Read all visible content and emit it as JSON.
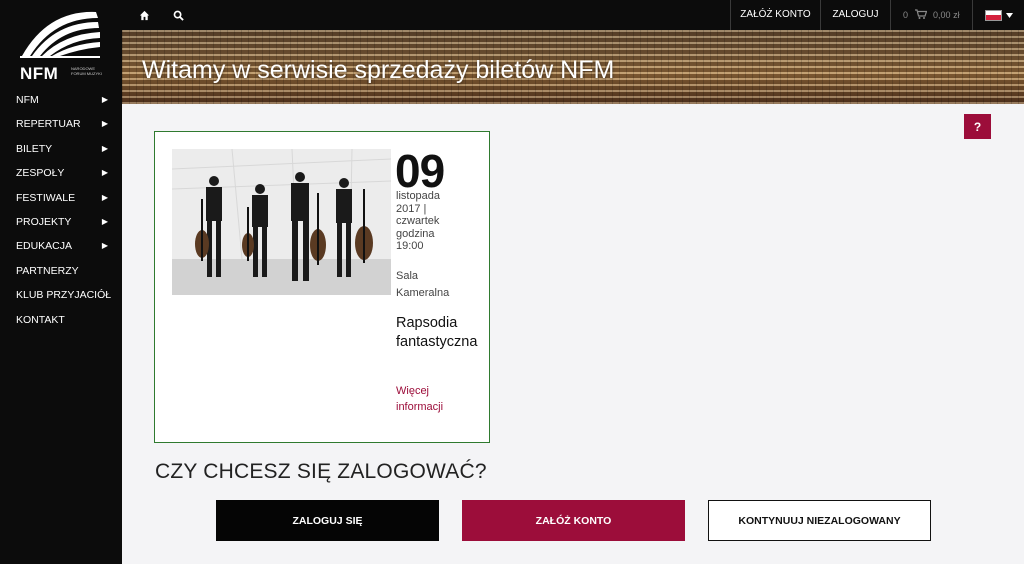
{
  "brand": {
    "logo_text": "NFM",
    "logo_subtitle": "NARODOWE FORUM MUZYKI"
  },
  "sidebar": {
    "items": [
      {
        "label": "NFM",
        "has_arrow": true
      },
      {
        "label": "REPERTUAR",
        "has_arrow": true
      },
      {
        "label": "BILETY",
        "has_arrow": true
      },
      {
        "label": "ZESPOŁY",
        "has_arrow": true
      },
      {
        "label": "FESTIWALE",
        "has_arrow": true
      },
      {
        "label": "PROJEKTY",
        "has_arrow": true
      },
      {
        "label": "EDUKACJA",
        "has_arrow": true
      },
      {
        "label": "PARTNERZY",
        "has_arrow": false
      },
      {
        "label": "KLUB PRZYJACIÓŁ",
        "has_arrow": false
      },
      {
        "label": "KONTAKT",
        "has_arrow": false
      }
    ]
  },
  "topbar": {
    "home_icon": "home-icon",
    "search_icon": "search-icon",
    "register_label": "ZAŁÓŻ KONTO",
    "login_label": "ZALOGUJ",
    "cart_count": "0",
    "cart_total": "0,00 zł",
    "language": "pl"
  },
  "banner": {
    "title": "Witamy w serwisie sprzedaży biletów NFM"
  },
  "help": {
    "label": "?"
  },
  "event": {
    "day": "09",
    "date_lines": [
      "listopada",
      "2017 |",
      "czwartek",
      "godzina",
      "19:00"
    ],
    "venue_lines": [
      "Sala",
      "Kameralna"
    ],
    "title": "Rapsodia fantastyczna",
    "more_lines": [
      "Więcej",
      "informacji"
    ]
  },
  "login_prompt": {
    "question": "CZY CHCESZ SIĘ ZALOGOWAĆ?",
    "login_button": "ZALOGUJ SIĘ",
    "register_button": "ZAŁÓŻ KONTO",
    "continue_button": "KONTYNUUJ NIEZALOGOWANY"
  },
  "colors": {
    "accent": "#9c0d3a",
    "dark": "#0c0c0c",
    "card_border": "#2f7a2f"
  }
}
